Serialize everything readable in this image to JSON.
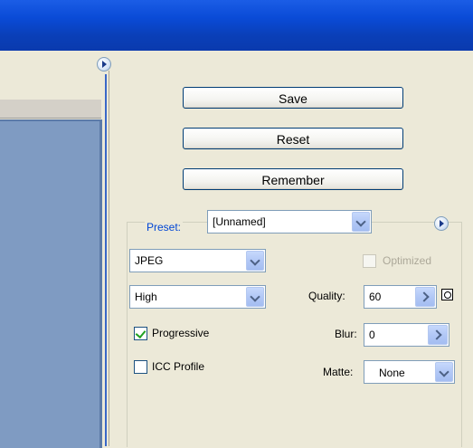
{
  "buttons": {
    "save": "Save",
    "reset": "Reset",
    "remember": "Remember"
  },
  "preset": {
    "label": "Preset:",
    "value": "[Unnamed]"
  },
  "format": {
    "value": "JPEG"
  },
  "quality_level": {
    "value": "High"
  },
  "optimized": {
    "label": "Optimized",
    "checked": false,
    "enabled": false
  },
  "quality": {
    "label": "Quality:",
    "value": "60"
  },
  "progressive": {
    "label": "Progressive",
    "checked": true
  },
  "blur": {
    "label": "Blur:",
    "value": "0"
  },
  "icc_profile": {
    "label": "ICC Profile",
    "checked": false
  },
  "matte": {
    "label": "Matte:",
    "value": "None"
  },
  "colors": {
    "title_bar": "#0a4bd7",
    "preset_label": "#0046d5",
    "check": "#21a121"
  }
}
